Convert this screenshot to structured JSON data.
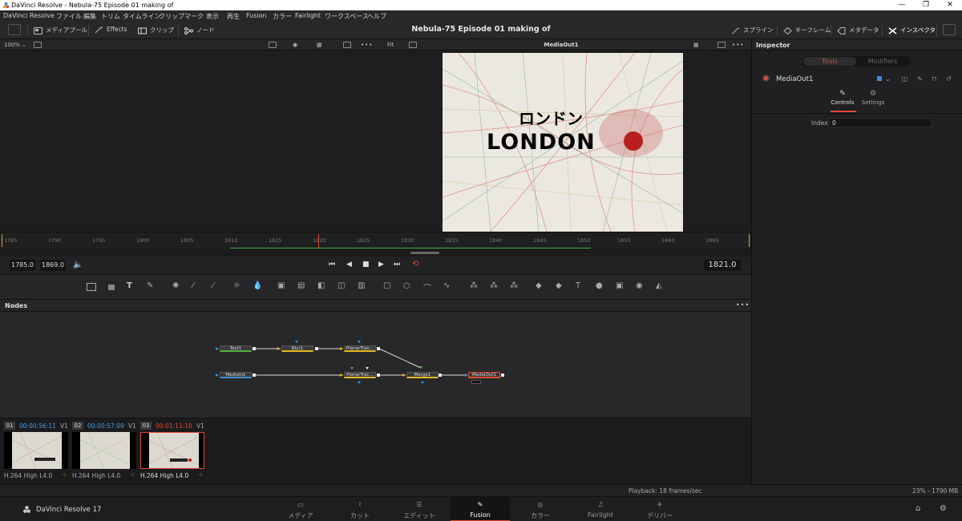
{
  "window": {
    "title": "DaVinci Resolve - Nebula-75 Episode 01 making of",
    "minimize": "—",
    "maximize": "❐",
    "close": "✕"
  },
  "menu": [
    "DaVinci Resolve",
    "ファイル",
    "編集",
    "トリム",
    "タイムライン",
    "クリップ",
    "マーク",
    "表示",
    "再生",
    "Fusion",
    "カラー",
    "Fairlight",
    "ワークスペース",
    "ヘルプ"
  ],
  "toolbar": {
    "media_pool": "メディアプール",
    "effects": "Effects",
    "clips": "クリップ",
    "nodes": "ノード",
    "project_title": "Nebula-75 Episode 01 making of",
    "spline": "スプライン",
    "keyframes": "キーフレーム",
    "metadata": "メタデータ",
    "inspector": "インスペクタ"
  },
  "viewer_left": {
    "zoom": "100%"
  },
  "viewer_right": {
    "zoom": "Fit",
    "title": "MediaOut1",
    "overlay_jp": "ロンドン",
    "overlay_en": "LONDON"
  },
  "ruler": {
    "ticks": [
      "1785",
      "1790",
      "1795",
      "1800",
      "1805",
      "1810",
      "1815",
      "1820",
      "1825",
      "1830",
      "1835",
      "1840",
      "1845",
      "1850",
      "1855",
      "1860",
      "1865"
    ]
  },
  "transport": {
    "in": "1785.0",
    "out": "1869.0",
    "current": "1821.0"
  },
  "nodes": {
    "title": "Nodes",
    "items": [
      "Text1",
      "Blur1",
      "PlanarTran...",
      "MediaIn1",
      "PlanarTrac...",
      "Merge1",
      "MediaOut1"
    ]
  },
  "clips": [
    {
      "num": "01",
      "tc": "00:00:56:11",
      "track": "V1",
      "codec": "H.264 High L4.0"
    },
    {
      "num": "02",
      "tc": "00:00:57:09",
      "track": "V1",
      "codec": "H.264 High L4.0"
    },
    {
      "num": "03",
      "tc": "00:01:11:10",
      "track": "V1",
      "codec": "H.264 High L4.0"
    }
  ],
  "inspector": {
    "title": "Inspector",
    "tab_tools": "Tools",
    "tab_modifiers": "Modifiers",
    "node_name": "MediaOut1",
    "sub_controls": "Controls",
    "sub_settings": "Settings",
    "index_label": "Index",
    "index_value": "0"
  },
  "status": {
    "playback": "Playback: 18 frames/sec",
    "memory": "23% - 1790 MB"
  },
  "pages": {
    "app": "DaVinci Resolve 17",
    "items": [
      "メディア",
      "カット",
      "エディット",
      "Fusion",
      "カラー",
      "Fairlight",
      "デリバー"
    ],
    "active": "Fusion"
  },
  "colors": {
    "accent": "#e04a33",
    "timecode_blue": "#3ea0e8",
    "timecode_red": "#e24a3a",
    "node_yellow": "#e6b820",
    "node_green": "#56b13c",
    "node_blue": "#3f8fd8"
  }
}
